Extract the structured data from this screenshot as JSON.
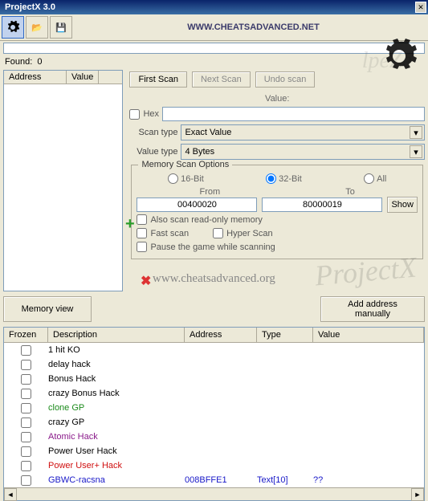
{
  "title": "ProjectX 3.0",
  "banner": "WWW.CHEATSADVANCED.NET",
  "found_label": "Found:",
  "found_count": "0",
  "left_cols": {
    "address": "Address",
    "value": "Value"
  },
  "scan_btns": {
    "first": "First Scan",
    "next": "Next Scan",
    "undo": "Undo scan"
  },
  "value_label": "Value:",
  "hex_label": "Hex",
  "value_input": "",
  "scan_type_label": "Scan type",
  "scan_type_value": "Exact Value",
  "value_type_label": "Value type",
  "value_type_value": "4 Bytes",
  "mem_group": {
    "title": "Memory Scan Options",
    "r16": "16-Bit",
    "r32": "32-Bit",
    "rall": "All",
    "from_label": "From",
    "to_label": "To",
    "from_val": "00400020",
    "to_val": "80000019",
    "show": "Show",
    "chk_ro": "Also scan read-only memory",
    "chk_fast": "Fast scan",
    "chk_hyper": "Hyper Scan",
    "chk_pause": "Pause the game while scanning"
  },
  "watermark1": "lpeZé",
  "watermark2": "ProjectX",
  "watermark3": "www.cheatsadvanced.org",
  "btn_memview": "Memory view",
  "btn_addaddr": "Add address manually",
  "table_cols": {
    "frozen": "Frozen",
    "desc": "Description",
    "addr": "Address",
    "type": "Type",
    "val": "Value"
  },
  "rows": [
    {
      "desc": "1 hit KO",
      "addr": "",
      "type": "",
      "val": "",
      "cls": ""
    },
    {
      "desc": "delay hack",
      "addr": "",
      "type": "",
      "val": "",
      "cls": ""
    },
    {
      "desc": "Bonus Hack",
      "addr": "",
      "type": "",
      "val": "",
      "cls": ""
    },
    {
      "desc": "crazy Bonus Hack",
      "addr": "",
      "type": "",
      "val": "",
      "cls": ""
    },
    {
      "desc": "clone GP",
      "addr": "",
      "type": "",
      "val": "",
      "cls": "c-green"
    },
    {
      "desc": "crazy GP",
      "addr": "",
      "type": "",
      "val": "",
      "cls": ""
    },
    {
      "desc": "Atomic Hack",
      "addr": "",
      "type": "",
      "val": "",
      "cls": "c-purple"
    },
    {
      "desc": "Power User Hack",
      "addr": "",
      "type": "",
      "val": "",
      "cls": ""
    },
    {
      "desc": "Power User+ Hack",
      "addr": "",
      "type": "",
      "val": "",
      "cls": "c-red"
    },
    {
      "desc": "GBWC-racsna",
      "addr": "008BFFE1",
      "type": "Text[10]",
      "val": "??",
      "cls": "c-blue"
    }
  ]
}
